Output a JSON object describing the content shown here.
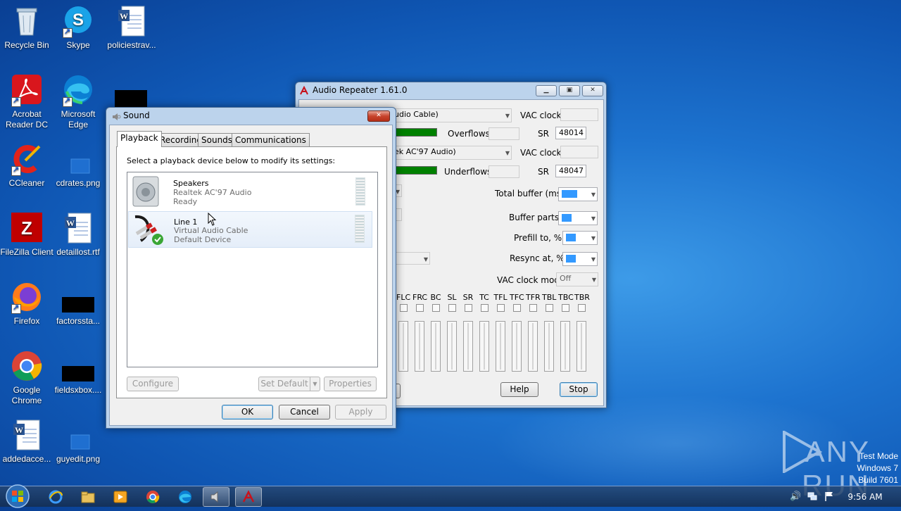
{
  "desktop": {
    "icons": [
      {
        "label": "Recycle Bin"
      },
      {
        "label": "Skype"
      },
      {
        "label": "policiestrav..."
      },
      {
        "label": "Acrobat Reader DC"
      },
      {
        "label": "Microsoft Edge"
      },
      {
        "label": "CCleaner"
      },
      {
        "label": "cdrates.png"
      },
      {
        "label": "FileZilla Client"
      },
      {
        "label": "detaillost.rtf"
      },
      {
        "label": "Firefox"
      },
      {
        "label": "factorssta..."
      },
      {
        "label": "Google Chrome"
      },
      {
        "label": "fieldsxbox...."
      },
      {
        "label": "addedacce..."
      },
      {
        "label": "guyedit.png"
      }
    ]
  },
  "audio_repeater": {
    "title": "Audio Repeater 1.61.0",
    "input_device": "udio Cable)",
    "output_device": "ek AC'97 Audio)",
    "vac_clock_label": "VAC clock",
    "overflows_label": "Overflows",
    "underflows_label": "Underflows",
    "sr_label": "SR",
    "sr_in": "48014",
    "sr_out": "48047",
    "total_buffer_label": "Total buffer (ms)",
    "buffer_parts_label": "Buffer parts",
    "prefill_label": "Prefill to, %",
    "resync_label": "Resync at, %",
    "vac_clock_mode_label": "VAC clock mode",
    "vac_clock_mode_value": "Off",
    "channels": [
      "FLC",
      "FRC",
      "BC",
      "SL",
      "SR",
      "TC",
      "TFL",
      "TFC",
      "TFR",
      "TBL",
      "TBC",
      "TBR"
    ],
    "help_label": "Help",
    "stop_label": "Stop"
  },
  "sound_dialog": {
    "title": "Sound",
    "tabs": [
      {
        "label": "Playback"
      },
      {
        "label": "Recording"
      },
      {
        "label": "Sounds"
      },
      {
        "label": "Communications"
      }
    ],
    "instruction": "Select a playback device below to modify its settings:",
    "devices": [
      {
        "name": "Speakers",
        "driver": "Realtek AC'97 Audio",
        "status": "Ready"
      },
      {
        "name": "Line 1",
        "driver": "Virtual Audio Cable",
        "status": "Default Device"
      }
    ],
    "configure_label": "Configure",
    "set_default_label": "Set Default",
    "properties_label": "Properties",
    "ok_label": "OK",
    "cancel_label": "Cancel",
    "apply_label": "Apply"
  },
  "taskbar": {
    "time": "9:56 AM"
  },
  "watermark": {
    "brand": "ANY RUN",
    "line1": "Test Mode",
    "line2": "Windows 7",
    "line3": "Build 7601"
  },
  "colors": {
    "meter_green": "#008000",
    "selection_blue": "#3399ff"
  }
}
